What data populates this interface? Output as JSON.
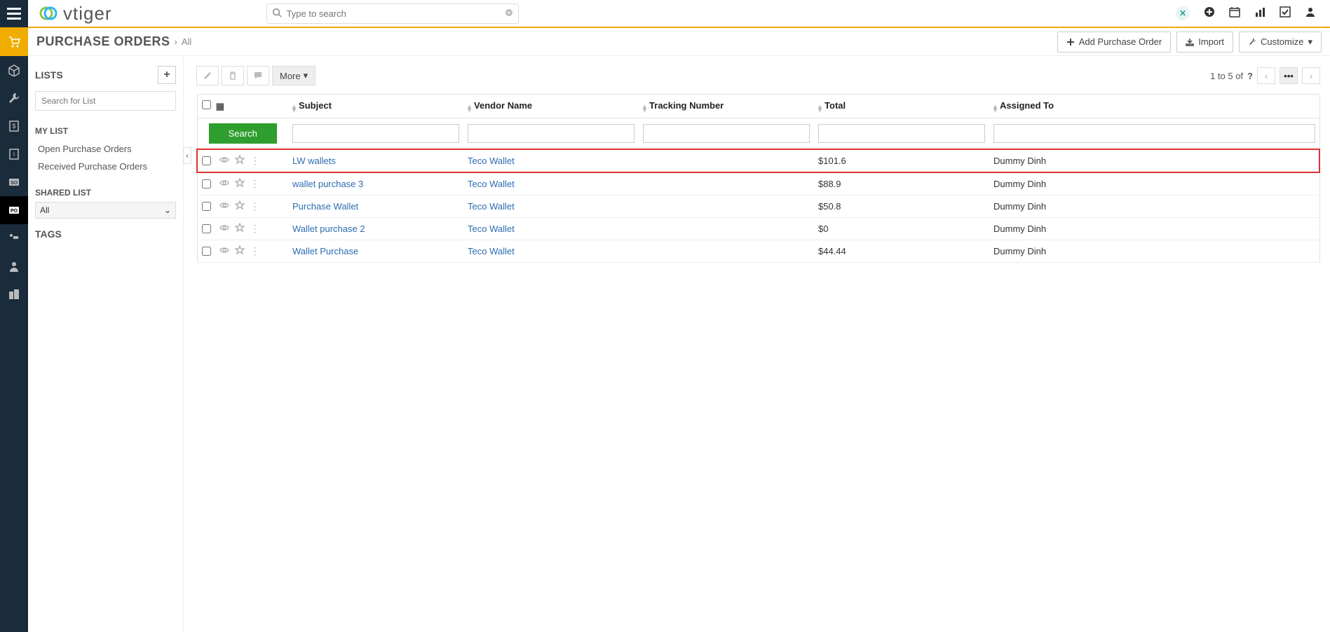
{
  "global_search_placeholder": "Type to search",
  "breadcrumb": {
    "title": "PURCHASE ORDERS",
    "sub": "All"
  },
  "actions": {
    "add": "Add Purchase Order",
    "import": "Import",
    "customize": "Customize"
  },
  "sidebar": {
    "lists_heading": "LISTS",
    "search_placeholder": "Search for List",
    "mylist_heading": "MY LIST",
    "mylist": [
      "Open Purchase Orders",
      "Received Purchase Orders"
    ],
    "sharedlist_heading": "SHARED LIST",
    "shared_selected": "All",
    "tags_heading": "TAGS"
  },
  "toolbar": {
    "more": "More"
  },
  "pager": {
    "text": "1 to 5  of ",
    "q": "?"
  },
  "columns": {
    "subject": "Subject",
    "vendor": "Vendor Name",
    "tracking": "Tracking Number",
    "total": "Total",
    "assigned": "Assigned To"
  },
  "search_button": "Search",
  "rows": [
    {
      "subject": "LW wallets",
      "vendor": "Teco Wallet",
      "tracking": "",
      "total": "$101.6",
      "assigned": "Dummy Dinh",
      "highlight": true
    },
    {
      "subject": "wallet purchase 3",
      "vendor": "Teco Wallet",
      "tracking": "",
      "total": "$88.9",
      "assigned": "Dummy Dinh"
    },
    {
      "subject": "Purchase Wallet",
      "vendor": "Teco Wallet",
      "tracking": "",
      "total": "$50.8",
      "assigned": "Dummy Dinh"
    },
    {
      "subject": "Wallet purchase 2",
      "vendor": "Teco Wallet",
      "tracking": "",
      "total": "$0",
      "assigned": "Dummy Dinh"
    },
    {
      "subject": "Wallet Purchase",
      "vendor": "Teco Wallet",
      "tracking": "",
      "total": "$44.44",
      "assigned": "Dummy Dinh"
    }
  ]
}
